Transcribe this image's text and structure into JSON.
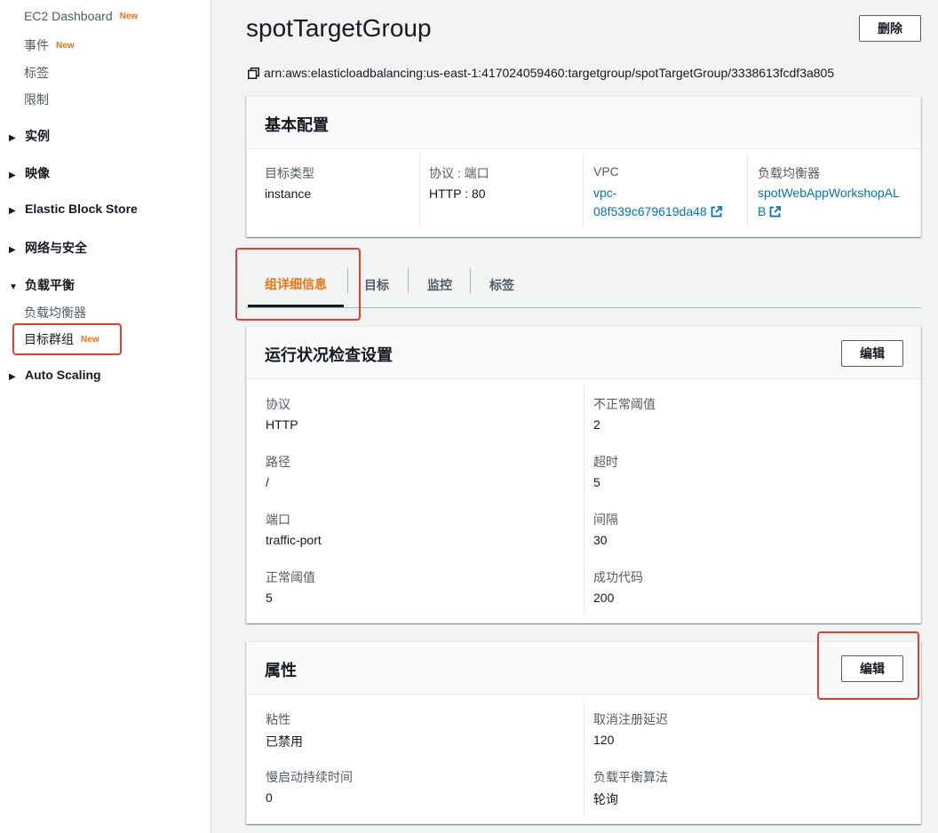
{
  "sidebar": {
    "top_links": [
      {
        "label": "EC2 Dashboard",
        "badge": "New"
      },
      {
        "label": "事件",
        "badge": "New"
      },
      {
        "label": "标签"
      },
      {
        "label": "限制"
      }
    ],
    "sections": [
      {
        "label": "实例",
        "expanded": false
      },
      {
        "label": "映像",
        "expanded": false
      },
      {
        "label": "Elastic Block Store",
        "expanded": false
      },
      {
        "label": "网络与安全",
        "expanded": false
      },
      {
        "label": "负载平衡",
        "expanded": true,
        "items": [
          {
            "label": "负载均衡器"
          },
          {
            "label": "目标群组",
            "badge": "New",
            "selected": true
          }
        ]
      },
      {
        "label": "Auto Scaling",
        "expanded": false
      }
    ]
  },
  "page": {
    "title": "spotTargetGroup",
    "delete_label": "删除",
    "arn": "arn:aws:elasticloadbalancing:us-east-1:417024059460:targetgroup/spotTargetGroup/3338613fcdf3a805"
  },
  "basic_config": {
    "title": "基本配置",
    "target_type": {
      "label": "目标类型",
      "value": "instance"
    },
    "protocol_port": {
      "label": "协议 : 端口",
      "value": "HTTP : 80"
    },
    "vpc": {
      "label": "VPC",
      "line1": "vpc-",
      "line2": "08f539c679619da48"
    },
    "load_balancer": {
      "label": "负载均衡器",
      "line1": "spotWebAppWorkshopAL",
      "line2": "B"
    }
  },
  "tabs": [
    {
      "label": "组详细信息",
      "active": true
    },
    {
      "label": "目标"
    },
    {
      "label": "监控"
    },
    {
      "label": "标签"
    }
  ],
  "health_check": {
    "title": "运行状况检查设置",
    "edit_label": "编辑",
    "left": [
      {
        "label": "协议",
        "value": "HTTP"
      },
      {
        "label": "路径",
        "value": "/"
      },
      {
        "label": "端口",
        "value": "traffic-port"
      },
      {
        "label": "正常阈值",
        "value": "5"
      }
    ],
    "right": [
      {
        "label": "不正常阈值",
        "value": "2"
      },
      {
        "label": "超时",
        "value": "5"
      },
      {
        "label": "间隔",
        "value": "30"
      },
      {
        "label": "成功代码",
        "value": "200"
      }
    ]
  },
  "attributes": {
    "title": "属性",
    "edit_label": "编辑",
    "left": [
      {
        "label": "粘性",
        "value": "已禁用"
      },
      {
        "label": "慢启动持续时间",
        "value": "0"
      }
    ],
    "right": [
      {
        "label": "取消注册延迟",
        "value": "120"
      },
      {
        "label": "负载平衡算法",
        "value": "轮询"
      }
    ]
  },
  "colors": {
    "highlight": "#e53e2f",
    "accent": "#ec7211",
    "link": "#0073bb"
  },
  "icons": [
    "copy-icon",
    "external-link-icon",
    "caret-right-icon",
    "caret-down-icon"
  ]
}
